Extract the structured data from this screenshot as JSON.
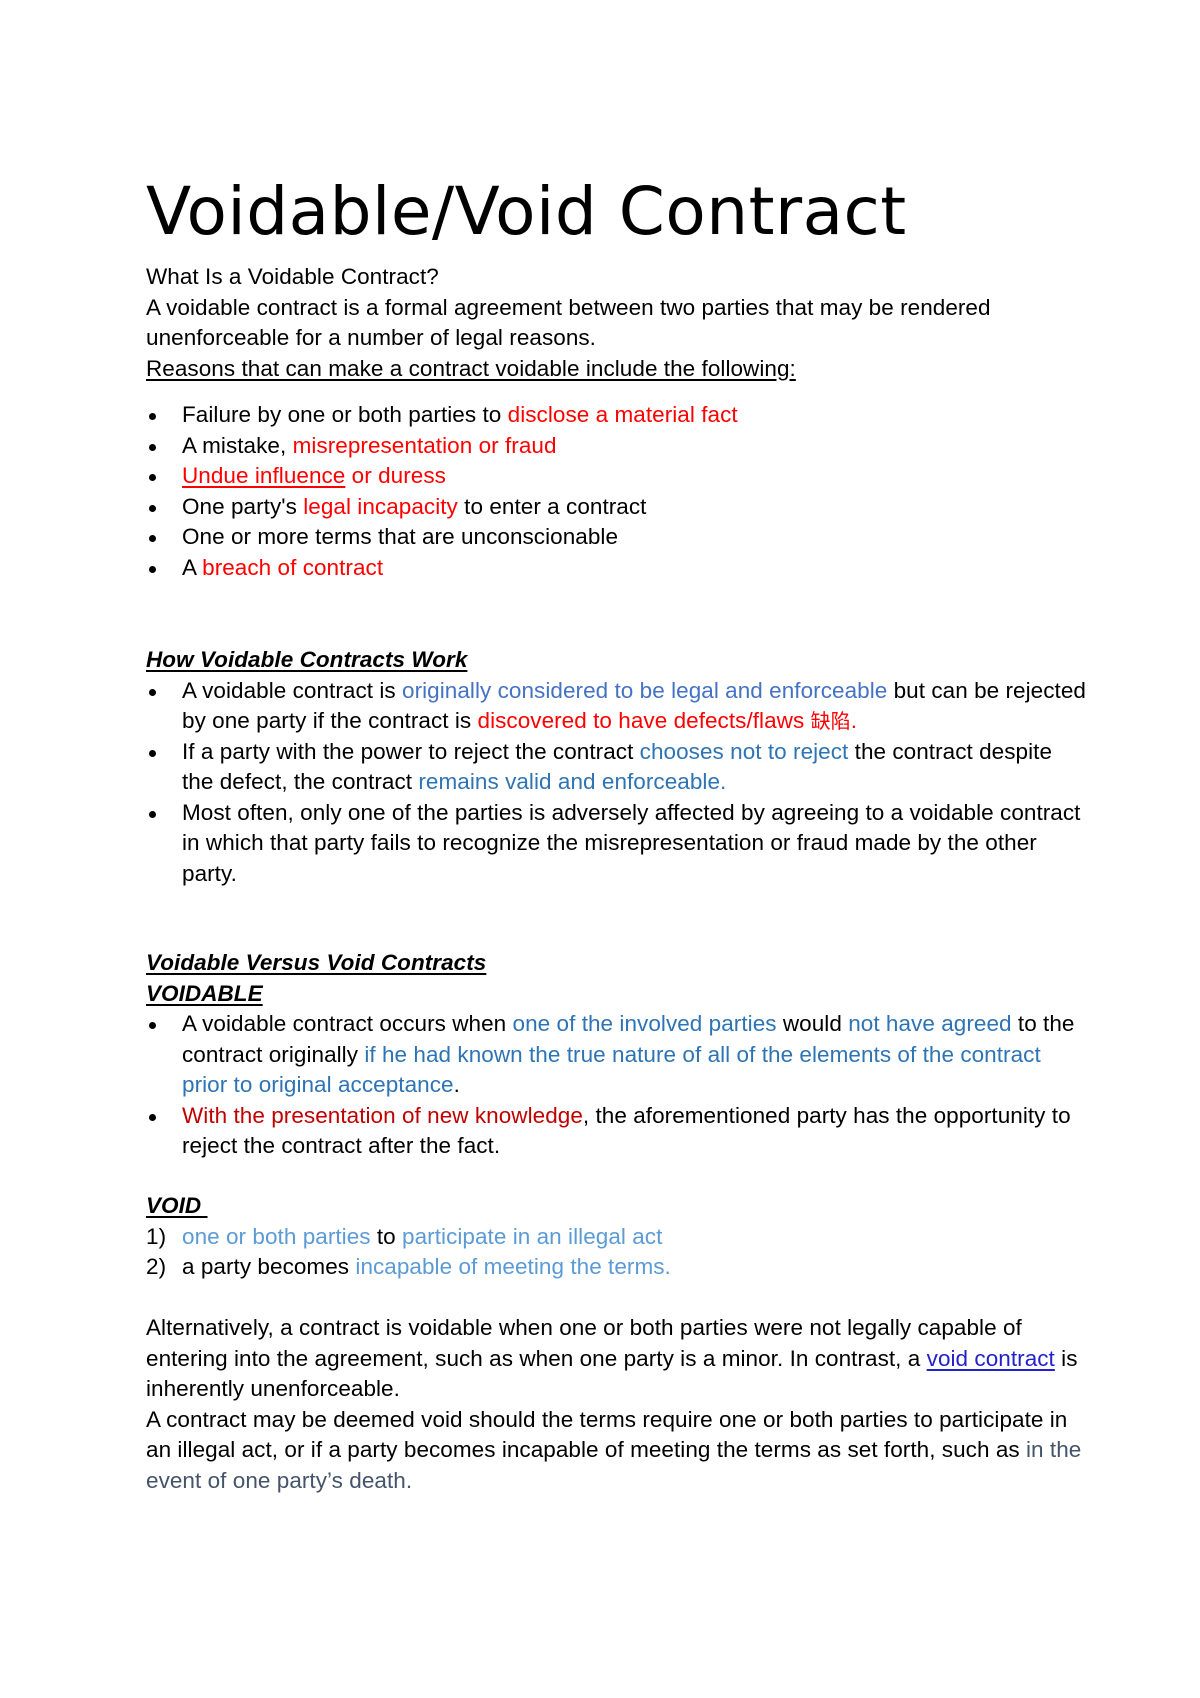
{
  "document": {
    "title": "Voidable/Void Contract",
    "intro": {
      "question": "What Is a Voidable Contract?",
      "definition": "A voidable contract is a formal agreement between two parties that may be rendered unenforceable for a number of legal reasons.",
      "reasons_heading": "Reasons that can make a contract voidable include the following:"
    },
    "reasons": [
      {
        "pre": "Failure by one or both parties to ",
        "hl": "disclose a material fact",
        "post": ""
      },
      {
        "pre": "A mistake, ",
        "hl": "misrepresentation or fraud",
        "post": ""
      },
      {
        "pre": "",
        "hl_underlined": "Undue influence",
        "hl": " or duress",
        "post": ""
      },
      {
        "pre": "One party's ",
        "hl": "legal incapacity",
        "post": " to enter a contract"
      },
      {
        "pre": "One or more terms that are unconscionable",
        "hl": "",
        "post": ""
      },
      {
        "pre": "A ",
        "hl": "breach of contract",
        "post": ""
      }
    ],
    "how_it_works": {
      "heading": "How Voidable Contracts Work",
      "items": [
        {
          "a": "A voidable contract is ",
          "b": "originally considered to be legal and enforceable",
          "c": " but can be rejected by one party if the contract is ",
          "d": "discovered to have defects/flaws ",
          "cjk": "缺陷",
          "e": "."
        },
        {
          "a": "If a party with the power to reject the contract ",
          "b": "chooses not to reject",
          "c": " the contract despite the defect, the contract ",
          "d": "remains valid and enforceable."
        },
        {
          "a": "Most often, only one of the parties is adversely affected by agreeing to a voidable contract in which that party fails to recognize the misrepresentation or fraud made by the other party."
        }
      ]
    },
    "versus": {
      "heading": "Voidable Versus Void Contracts",
      "voidable_label": "VOIDABLE",
      "voidable_items": [
        {
          "a": "A voidable contract occurs when ",
          "b": "one of the involved parties",
          "c": " would ",
          "d": "not have agreed",
          "e": " to the contract originally ",
          "f": "if he had known the true nature of all of the elements of the contract prior to original acceptance",
          "g": "."
        },
        {
          "a": "With the presentation of new knowledge",
          "b": ", the aforementioned party has the opportunity to reject the contract after the fact."
        }
      ],
      "void_label": "VOID ",
      "void_items": [
        {
          "num": "1)",
          "a": "one or both parties",
          "b": " to ",
          "c": "participate in an illegal act"
        },
        {
          "num": "2)",
          "a": "a party becomes ",
          "b": "incapable of meeting the terms."
        }
      ]
    },
    "closing": {
      "p1_a": "Alternatively, a contract is voidable when one or both parties were not legally capable of entering into the agreement, such as when one party is a minor. In contrast, a ",
      "p1_link": "void contract",
      "p1_b": " is inherently unenforceable.",
      "p2_a": "A contract may be deemed void should the terms require one or both parties to participate in an illegal act, or if a party becomes incapable of meeting the terms as set forth, such as ",
      "p2_b": "in the event of one party’s death."
    }
  },
  "colors": {
    "text": "#000000",
    "red": "#ff0000",
    "dark_red": "#c00000",
    "blue_accent1": "#4472c4",
    "blue_accent5": "#2e74b5",
    "blue_light": "#5b9bd5",
    "slate": "#44546a",
    "link": "#2222cc"
  }
}
